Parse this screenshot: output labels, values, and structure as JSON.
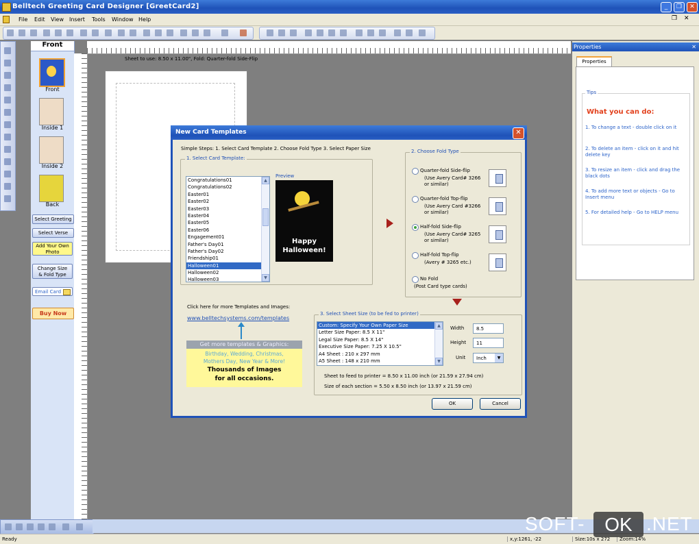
{
  "window": {
    "title": "Belltech Greeting Card Designer   [GreetCard2]"
  },
  "menu": [
    "File",
    "Edit",
    "View",
    "Insert",
    "Tools",
    "Window",
    "Help"
  ],
  "pages_panel": {
    "header": "Front",
    "pages": [
      "Front",
      "Inside 1",
      "Inside 2",
      "Back"
    ],
    "buttons": [
      "Select Greeting",
      "Select Verse",
      "Add Your Own Photo",
      "Change Size & Fold Type",
      "Email Card",
      "Buy Now"
    ]
  },
  "canvas": {
    "sheet_info": "Sheet to use: 8.50 x 11.00\", Fold: Quarter-fold Side-Flip"
  },
  "properties": {
    "title": "Properties",
    "tab": "Properties",
    "tips_label": "Tips",
    "tips_heading": "What you can do:",
    "tips": [
      "1. To change a text - double click on it",
      "2. To delete an item - click on it and hit delete key",
      "3. To resize an item - click and drag the black dots",
      "4. To add more text or objects - Go to Insert menu",
      "5. For detailed help - Go to HELP menu"
    ]
  },
  "dialog": {
    "title": "New Card Templates",
    "steps": "Simple Steps: 1. Select Card Template  2. Choose Fold Type  3. Select Paper Size",
    "template_group": "1. Select Card Template:",
    "templates": [
      "Congratulations01",
      "Congratulations02",
      "Easter01",
      "Easter02",
      "Easter03",
      "Easter04",
      "Easter05",
      "Easter06",
      "Engagement01",
      "Father's Day01",
      "Father's Day02",
      "Friendship01",
      "Halloween01",
      "Halloween02",
      "Halloween03"
    ],
    "selected_template": "Halloween01",
    "preview_label": "Preview",
    "preview_text": "Happy Halloween!",
    "more_label": "Click here for more Templates and Images:",
    "more_link": "www.belltechsystems.com/templates",
    "promo": {
      "title": "Get more templates & Graphics:",
      "line1": "Birthday, Wedding, Christmas,",
      "line2": "Mothers Day, New Year & More!",
      "line3": "Thousands of Images",
      "line4": "for all occasions."
    },
    "fold_group": "2. Choose Fold Type",
    "fold_options": [
      {
        "label": "Quarter-fold Side-flip",
        "note": "(Use Avery Card# 3266 or similar)",
        "selected": false
      },
      {
        "label": "Quarter-fold Top-flip",
        "note": "(Use Avery Card #3266 or similar)",
        "selected": false
      },
      {
        "label": "Half-fold Side-flip",
        "note": "(Use Avery Card# 3265 or similar)",
        "selected": true
      },
      {
        "label": "Half-fold Top-flip",
        "note": "(Avery # 3265 etc.)",
        "selected": false
      },
      {
        "label": "No Fold",
        "note": "(Post Card type cards)",
        "selected": false
      }
    ],
    "size_group": "3. Select Sheet Size (to be fed to printer)",
    "sizes": [
      "Custom: Specify Your Own Paper Size",
      "Letter Size Paper: 8.5 X 11\"",
      "Legal Size Paper: 8.5 X 14\"",
      "Executive Size Paper: 7.25  X 10.5\"",
      "A4 Sheet : 210 x 297 mm",
      "A5 Sheet : 148 x 210 mm"
    ],
    "selected_size": "Custom: Specify Your Own Paper Size",
    "width_label": "Width",
    "width_value": "8.5",
    "height_label": "Height",
    "height_value": "11",
    "unit_label": "Unit",
    "unit_value": "Inch",
    "sheet_feed": "Sheet to feed to printer = 8.50 x 11.00 inch (or 21.59 x 27.94 cm)",
    "section_size": "Size of each section = 5.50 x 8.50 inch (or 13.97 x 21.59 cm)",
    "ok": "OK",
    "cancel": "Cancel"
  },
  "status": {
    "ready": "Ready",
    "coords": "x,y:1261, -22",
    "size": "Size:10s x 272",
    "zoom": "Zoom:14%"
  },
  "watermark": {
    "left": "SOFT-",
    "mid": "OK",
    "right": ".NET"
  }
}
